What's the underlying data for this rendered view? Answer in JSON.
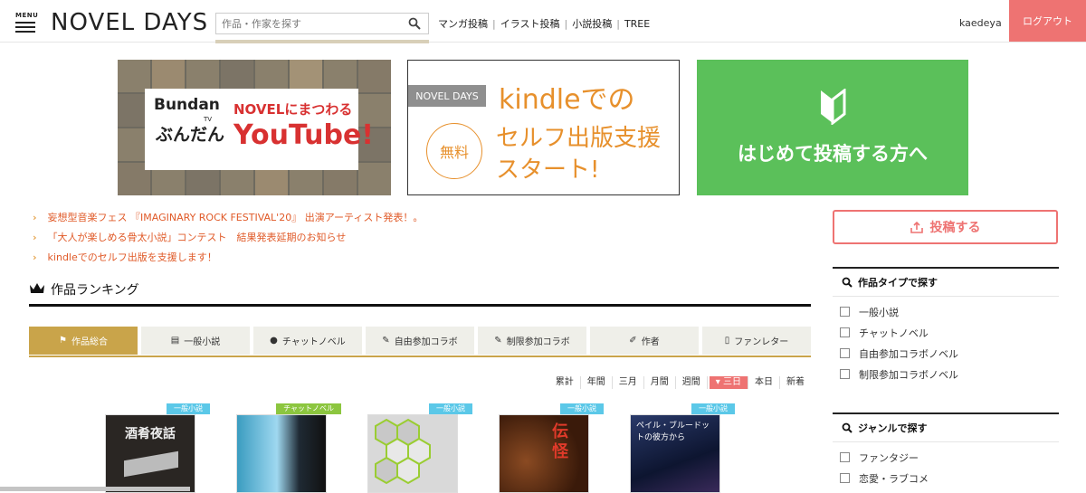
{
  "header": {
    "menu_label": "MENU",
    "logo_text": "NOVEL DAYS",
    "search_placeholder": "作品・作家を探す",
    "nav_links": [
      "マンガ投稿",
      "イラスト投稿",
      "小説投稿",
      "TREE"
    ],
    "username": "kaedeya",
    "logout_label": "ログアウト"
  },
  "banners": {
    "bundan": {
      "brand_roman": "Bundan",
      "brand_jp": "ぶんだん",
      "tv": "TV",
      "line1": "NOVELにまつわる",
      "line2": "YouTube!"
    },
    "kindle": {
      "tag": "NOVEL DAYS",
      "line1": "kindleでの",
      "line2": "セルフ出版支援",
      "line3": "スタート!",
      "badge": "無料"
    },
    "beginner": {
      "text": "はじめて投稿する方へ"
    }
  },
  "news": [
    "妄想型音楽フェス 『IMAGINARY ROCK FESTIVAL'20』 出演アーティスト発表！。",
    "「大人が楽しめる骨太小説」コンテスト　結果発表延期のお知らせ",
    "kindleでのセルフ出版を支援します！"
  ],
  "ranking": {
    "title": "作品ランキング",
    "tabs": [
      {
        "label": "作品総合",
        "icon": "flag-icon",
        "active": true
      },
      {
        "label": "一般小説",
        "icon": "book-icon",
        "active": false
      },
      {
        "label": "チャットノベル",
        "icon": "chat-icon",
        "active": false
      },
      {
        "label": "自由参加コラボ",
        "icon": "collab-icon",
        "active": false
      },
      {
        "label": "制限参加コラボ",
        "icon": "collab-icon",
        "active": false
      },
      {
        "label": "作者",
        "icon": "pen-icon",
        "active": false
      },
      {
        "label": "ファンレター",
        "icon": "letter-icon",
        "active": false
      }
    ],
    "periods": [
      "累計",
      "年間",
      "三月",
      "月間",
      "週間",
      "三日",
      "本日",
      "新着"
    ],
    "active_period": "三日",
    "works": [
      {
        "genre": "一般小説",
        "genre_color": "#5bc8e8",
        "thumb_text": "酒肴夜話"
      },
      {
        "genre": "チャットノベル",
        "genre_color": "#8cc63f",
        "thumb_text": ""
      },
      {
        "genre": "一般小説",
        "genre_color": "#5bc8e8",
        "thumb_text": ""
      },
      {
        "genre": "一般小説",
        "genre_color": "#5bc8e8",
        "thumb_text": "伝怪"
      },
      {
        "genre": "一般小説",
        "genre_color": "#5bc8e8",
        "thumb_text": "ペイル・ブルードットの彼方から"
      }
    ]
  },
  "sidebar": {
    "post_button": "投稿する",
    "type_heading": "作品タイプで探す",
    "types": [
      "一般小説",
      "チャットノベル",
      "自由参加コラボノベル",
      "制限参加コラボノベル"
    ],
    "genre_heading": "ジャンルで探す",
    "genres": [
      "ファンタジー",
      "恋愛・ラブコメ"
    ]
  },
  "colors": {
    "accent_red": "#ee7372",
    "gold": "#c9a44a",
    "green": "#5bc05a",
    "orange": "#e7902c"
  }
}
